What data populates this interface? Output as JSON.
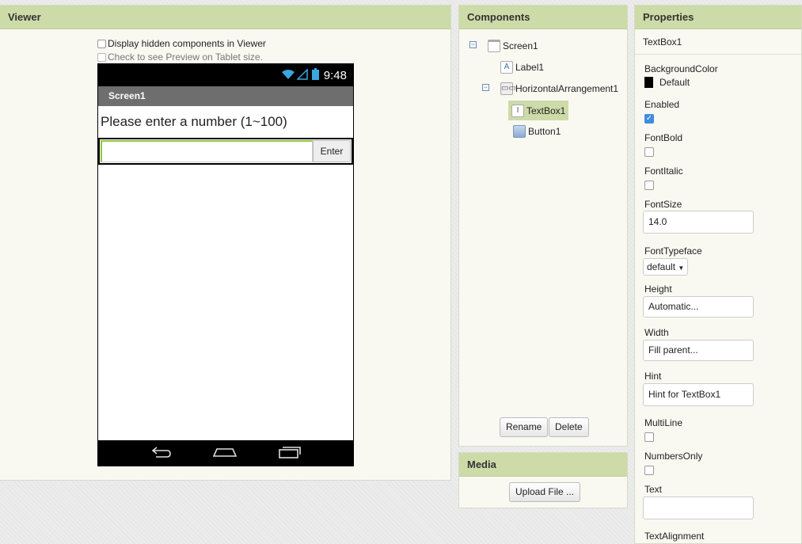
{
  "viewer": {
    "title": "Viewer",
    "hidden_label": "Display hidden components in Viewer",
    "tablet_label": "Check to see Preview on Tablet size.",
    "phone": {
      "time": "9:48",
      "screen_title": "Screen1",
      "label_text": "Please enter a number (1~100)",
      "button_text": "Enter"
    }
  },
  "components": {
    "title": "Components",
    "tree": [
      "Screen1",
      "Label1",
      "HorizontalArrangement1",
      "TextBox1",
      "Button1"
    ],
    "rename": "Rename",
    "delete": "Delete"
  },
  "media": {
    "title": "Media",
    "upload": "Upload File ..."
  },
  "properties": {
    "title": "Properties",
    "component": "TextBox1",
    "bg_label": "BackgroundColor",
    "bg_value": "Default",
    "bg_color": "#000000",
    "enabled_label": "Enabled",
    "fontbold_label": "FontBold",
    "fontitalic_label": "FontItalic",
    "fontsize_label": "FontSize",
    "fontsize_value": "14.0",
    "typeface_label": "FontTypeface",
    "typeface_value": "default",
    "height_label": "Height",
    "height_value": "Automatic...",
    "width_label": "Width",
    "width_value": "Fill parent...",
    "hint_label": "Hint",
    "hint_value": "Hint for TextBox1",
    "multiline_label": "MultiLine",
    "numbers_label": "NumbersOnly",
    "text_label": "Text",
    "text_value": "",
    "align_label": "TextAlignment"
  },
  "colors": {
    "header": "#cddba8",
    "accent": "#8fc33a"
  }
}
